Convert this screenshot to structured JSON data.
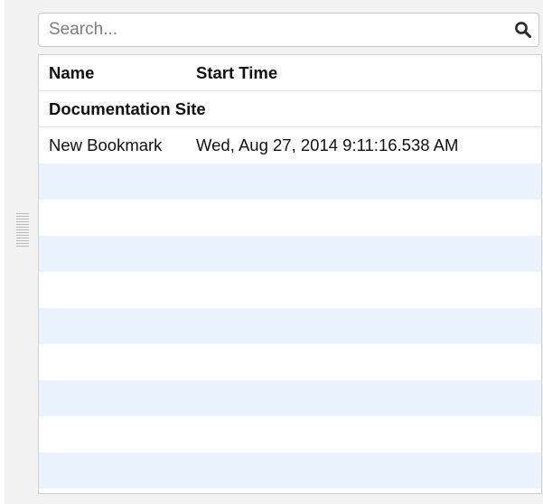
{
  "search": {
    "placeholder": "Search...",
    "value": "",
    "button_icon": "search-icon"
  },
  "grid": {
    "columns": [
      {
        "label": "Name"
      },
      {
        "label": "Start Time"
      }
    ],
    "group": {
      "label": "Documentation Site"
    },
    "rows": [
      {
        "name": "New Bookmark",
        "start_time": "Wed, Aug 27, 2014 9:11:16.538 AM"
      }
    ]
  },
  "colors": {
    "panel_bg": "#f2f2f2",
    "row_alt_bg": "#eaf3fc",
    "border": "#cfcfcf"
  }
}
